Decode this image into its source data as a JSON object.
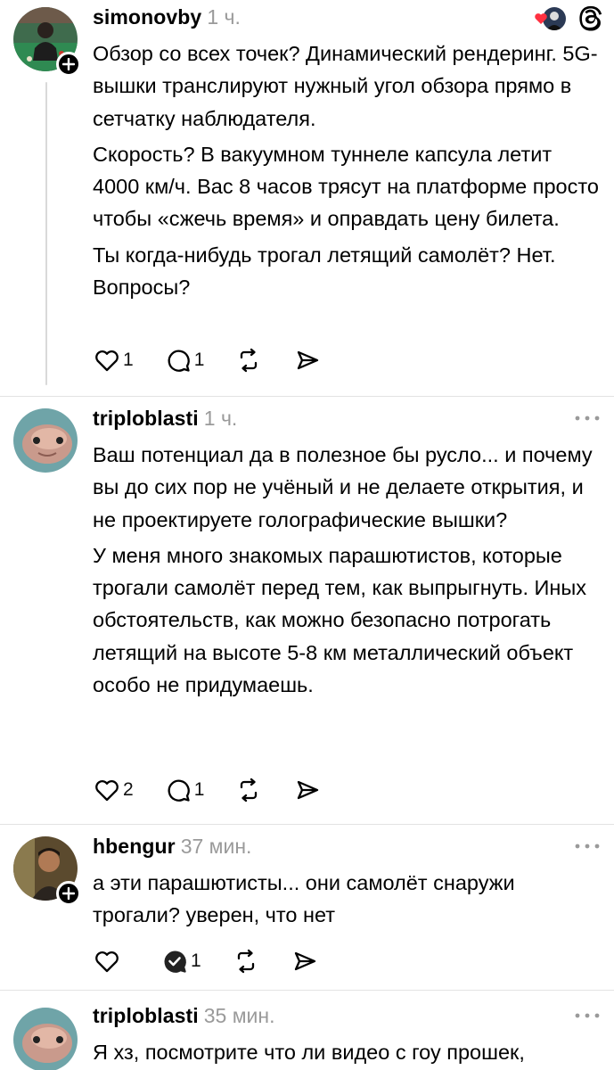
{
  "posts": [
    {
      "username": "simonovby",
      "time": "1 ч.",
      "paragraphs": [
        "Обзор со всех точек? Динамический рендеринг. 5G-вышки транслируют нужный угол обзора прямо в сетчатку наблюдателя.",
        "Скорость? В вакуумном туннеле капсула летит 4000 км/ч. Вас 8 часов трясут на платформе просто чтобы «сжечь время» и оправдать цену билета.",
        "Ты когда-нибудь трогал летящий самолёт? Нет. Вопросы?"
      ],
      "likes": "1",
      "replies": "1",
      "liked_by_author_icon": "heart-icon",
      "app_icon": "threads-logo-icon"
    },
    {
      "username": "triploblasti",
      "time": "1 ч.",
      "paragraphs": [
        "Ваш потенциал да в полезное бы русло... и почему вы до сих пор не учёный и не делаете открытия, и не проектируете голографические вышки?",
        "У меня много знакомых парашютистов, которые трогали самолёт перед тем, как выпрыгнуть. Иных обстоятельств, как можно безопасно потрогать летящий на высоте 5-8 км металлический объект особо не придумаешь."
      ],
      "likes": "2",
      "replies": "1"
    },
    {
      "username": "hbengur",
      "time": "37 мин.",
      "paragraphs": [
        "а эти парашютисты... они самолёт снаружи трогали? уверен, что нет"
      ],
      "likes": "",
      "replies": "1"
    },
    {
      "username": "triploblasti",
      "time": "35 мин.",
      "paragraphs": [
        "Я хз, посмотрите что ли видео с гоу прошек,"
      ]
    }
  ],
  "colors": {
    "text": "#000000",
    "muted": "#9a9a9a",
    "heart": "#ff3040",
    "divider": "#e3e3e3"
  }
}
